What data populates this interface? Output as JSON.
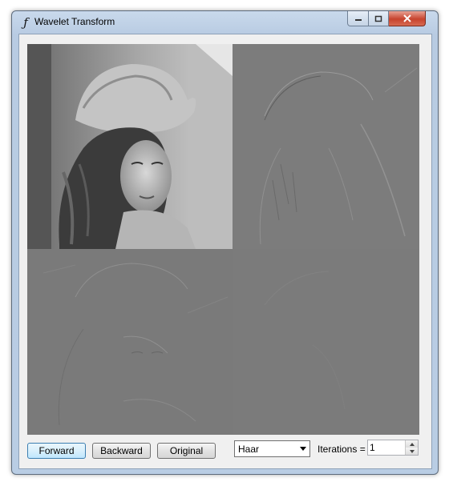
{
  "window": {
    "title": "Wavelet Transform",
    "icon": "function-icon",
    "controls": [
      "minimize-icon",
      "maximize-icon",
      "close-icon"
    ]
  },
  "canvas": {
    "quadrants": [
      "approximation",
      "horizontal-detail",
      "vertical-detail",
      "diagonal-detail"
    ]
  },
  "toolbar": {
    "forward_label": "Forward",
    "backward_label": "Backward",
    "original_label": "Original",
    "wavelet_selected": "Haar",
    "iterations_label": "Iterations =",
    "iterations_value": "1"
  },
  "colors": {
    "detail_gray": "#7b7b7b",
    "focus_border": "#3c7fb1",
    "close_button": "#c7432d"
  }
}
